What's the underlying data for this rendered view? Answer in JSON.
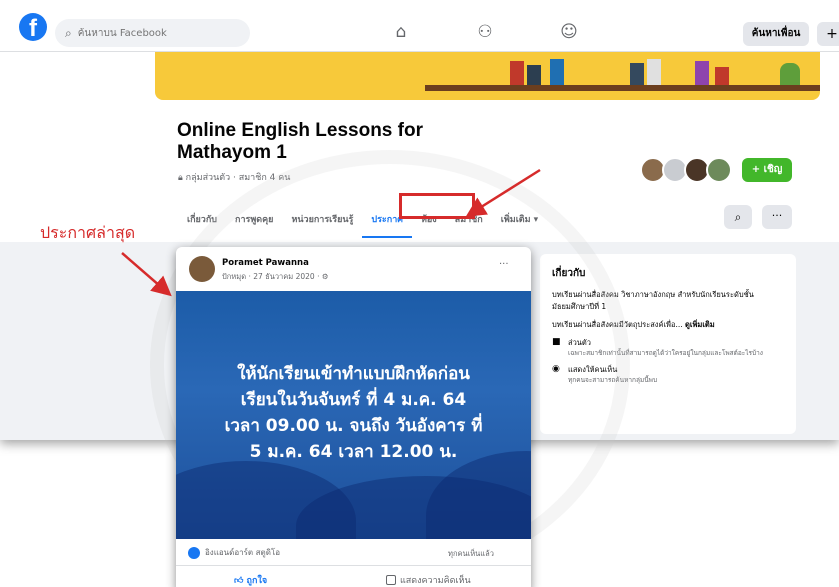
{
  "topbar": {
    "search_placeholder": "ค้นหาบน Facebook",
    "find_friends_label": "ค้นหาเพื่อน",
    "plus_label": "+"
  },
  "group": {
    "title": "Online English Lessons for Mathayom 1",
    "meta": "กลุ่มส่วนตัว · สมาชิก 4 คน",
    "invite_label": "+ เชิญ",
    "tabs": [
      {
        "label": "เกี่ยวกับ"
      },
      {
        "label": "การพูดคุย"
      },
      {
        "label": "หน่วยการเรียนรู้"
      },
      {
        "label": "ประกาศ"
      },
      {
        "label": "ห้อง"
      },
      {
        "label": "สมาชิก"
      },
      {
        "label": "เพิ่มเติม ▾"
      }
    ],
    "active_tab": "ประกาศ"
  },
  "about": {
    "heading": "เกี่ยวกับ",
    "description": "บทเรียนผ่านสื่อสังคม วิชาภาษาอังกฤษ สำหรับนักเรียนระดับชั้นมัธยมศึกษาปีที่ 1",
    "purpose": "บทเรียนผ่านสื่อสังคมมีวัตถุประสงค์เพื่อ...",
    "see_more": "ดูเพิ่มเติม",
    "private_title": "ส่วนตัว",
    "private_desc": "เฉพาะสมาชิกเท่านั้นที่สามารถดูได้ว่าใครอยู่ในกลุ่มและโพสต์อะไรบ้าง",
    "visible_title": "แสดงให้คนเห็น",
    "visible_desc": "ทุกคนจะสามารถค้นหากลุ่มนี้พบ"
  },
  "post": {
    "author": "Poramet Pawanna",
    "date": "ปักหมุด · 27 ธันวาคม 2020 · ⚙",
    "dots": "···",
    "message_lines": [
      "ให้นักเรียนเข้าทำแบบฝึกหัดก่อน",
      "เรียนในวันจันทร์ ที่ 4 ม.ค. 64",
      "เวลา 09.00 น. จนถึง วันอังคาร ที่",
      "5 ม.ค. 64 เวลา 12.00 น."
    ],
    "reactions": "อิงแอนด์อาร์ต สตูดิโอ",
    "seen_by": "ทุกคนเห็นแล้ว",
    "like_label": "ถูกใจ",
    "comment_label": "แสดงความคิดเห็น"
  },
  "annotation": {
    "latest_label": "ประกาศล่าสุด",
    "color": "#d62b2b"
  },
  "colors": {
    "brand": "#1877f2",
    "invite": "#42b72a",
    "post_bg": "#1c5ca8"
  }
}
